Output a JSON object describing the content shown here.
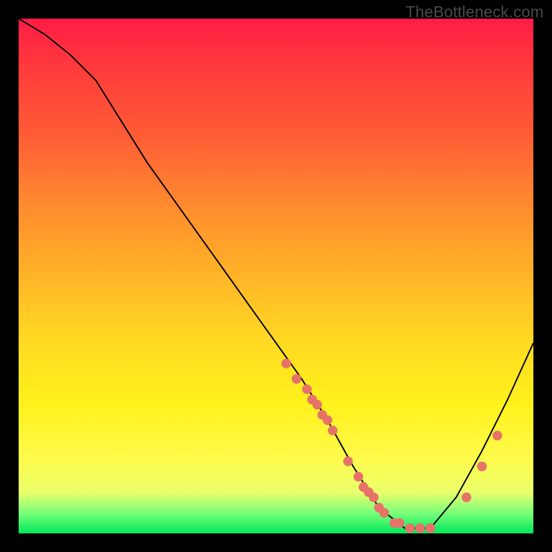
{
  "watermark": "TheBottleneck.com",
  "chart_data": {
    "type": "line",
    "title": "",
    "xlabel": "",
    "ylabel": "",
    "xlim": [
      0,
      100
    ],
    "ylim": [
      0,
      100
    ],
    "grid": false,
    "legend": false,
    "series": [
      {
        "name": "curve",
        "x": [
          0,
          5,
          10,
          15,
          20,
          25,
          30,
          35,
          40,
          45,
          50,
          55,
          60,
          65,
          70,
          75,
          80,
          85,
          90,
          95,
          100
        ],
        "y": [
          100,
          97,
          93,
          88,
          80,
          72,
          65,
          58,
          51,
          44,
          37,
          30,
          22,
          13,
          5,
          1,
          1,
          7,
          16,
          26,
          37
        ]
      },
      {
        "name": "markers",
        "type": "scatter",
        "x": [
          52,
          54,
          56,
          57,
          58,
          59,
          60,
          61,
          64,
          66,
          67,
          68,
          69,
          70,
          71,
          73,
          74,
          76,
          78,
          80,
          87,
          90,
          93
        ],
        "y": [
          33,
          30,
          28,
          26,
          25,
          23,
          22,
          20,
          14,
          11,
          9,
          8,
          7,
          5,
          4,
          2,
          2,
          1,
          1,
          1,
          7,
          13,
          19
        ]
      }
    ]
  },
  "colors": {
    "marker": "#e77269",
    "curve": "#000000",
    "background_top": "#ff1c44",
    "background_bottom": "#00e85a"
  }
}
